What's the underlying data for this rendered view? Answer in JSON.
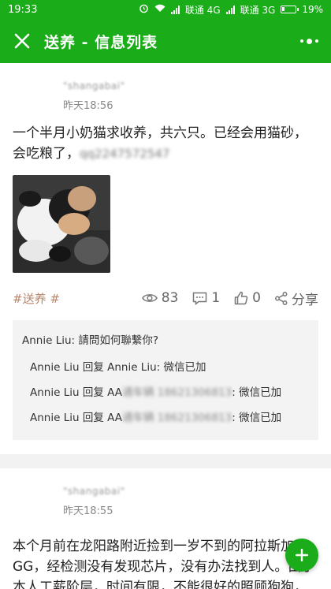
{
  "status_bar": {
    "time": "19:33",
    "carrier1": "联通 4G",
    "carrier2": "联通 3G",
    "battery": "19%"
  },
  "app_bar": {
    "title": "送养 - 信息列表"
  },
  "posts": [
    {
      "username": "\"shangabai\"",
      "time": "昨天18:56",
      "content": "一个半月小奶猫求收养，共六只。已经会用猫砂，会吃粮了，",
      "content_contact": "qq2247572547",
      "tag": "#送养 #",
      "views": "83",
      "comments": "1",
      "likes": "0",
      "share": "分享",
      "comment_list": [
        {
          "text": "Annie Liu: 請問如何聯繫你?"
        },
        {
          "prefix": "Annie Liu 回复 Annie Liu: ",
          "text": "微信已加",
          "blur": ""
        },
        {
          "prefix": "Annie Liu 回复 AA",
          "blur": "通车辆 18621306813",
          "text": ": 微信已加"
        },
        {
          "prefix": "Annie Liu 回复 AA",
          "blur": "通车辆 18621306813",
          "text": ": 微信已加"
        }
      ]
    },
    {
      "username": "\"shangabai\"",
      "time": "昨天18:55",
      "content": "本个月前在龙阳路附近捡到一岁不到的阿拉斯加GG，经检测没有发现芯片，没有办法找到人。由于本人工薪阶层，时间有限，不能很好的照顾狗狗，希望能给它找个比较靠谱的主"
    }
  ],
  "fab": {
    "icon": "plus-icon"
  },
  "colors": {
    "primary": "#1aad19",
    "tag": "#b8846a"
  }
}
